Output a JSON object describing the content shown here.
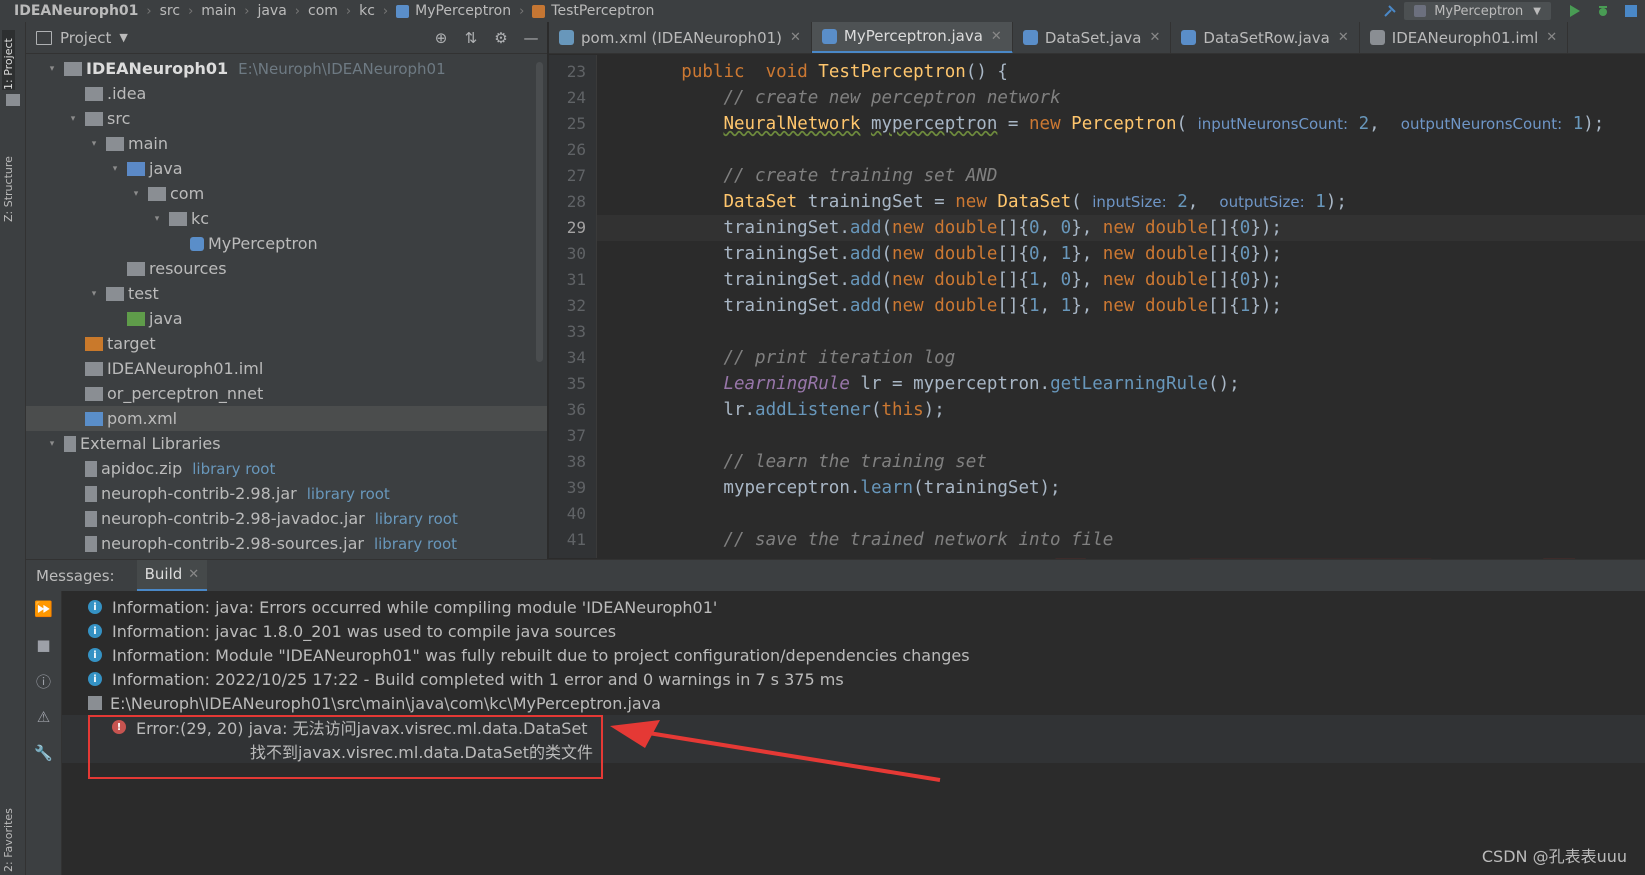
{
  "breadcrumb": [
    {
      "name": "IDEANeuroph01",
      "bold": true
    },
    {
      "name": "src"
    },
    {
      "name": "main"
    },
    {
      "name": "java"
    },
    {
      "name": "com"
    },
    {
      "name": "kc"
    },
    {
      "name": "MyPerceptron",
      "icon": "class-icon"
    },
    {
      "name": "TestPerceptron",
      "icon": "method-icon"
    }
  ],
  "run_config": {
    "name": "MyPerceptron"
  },
  "left_strip": {
    "project_tab": "1: Project",
    "structure_tab": "Z: Structure",
    "favorites_tab": "2: Favorites"
  },
  "project_panel": {
    "title": "Project",
    "tree": [
      {
        "label": "IDEANeuroph01",
        "hint": "E:\\Neuroph\\IDEANeuroph01",
        "depth": 0,
        "icon": "module-folder-icon",
        "bold": true,
        "expanded": true
      },
      {
        "label": ".idea",
        "depth": 1,
        "icon": "folder-icon"
      },
      {
        "label": "src",
        "depth": 1,
        "icon": "folder-icon",
        "expanded": true
      },
      {
        "label": "main",
        "depth": 2,
        "icon": "folder-icon",
        "expanded": true
      },
      {
        "label": "java",
        "depth": 3,
        "icon": "source-folder-icon",
        "expanded": true
      },
      {
        "label": "com",
        "depth": 4,
        "icon": "package-icon",
        "expanded": true
      },
      {
        "label": "kc",
        "depth": 5,
        "icon": "package-icon",
        "expanded": true
      },
      {
        "label": "MyPerceptron",
        "depth": 6,
        "icon": "java-class-icon"
      },
      {
        "label": "resources",
        "depth": 3,
        "icon": "resources-folder-icon"
      },
      {
        "label": "test",
        "depth": 2,
        "icon": "folder-icon",
        "expanded": true
      },
      {
        "label": "java",
        "depth": 3,
        "icon": "test-folder-icon"
      },
      {
        "label": "target",
        "depth": 1,
        "icon": "excluded-folder-icon"
      },
      {
        "label": "IDEANeuroph01.iml",
        "depth": 1,
        "icon": "iml-file-icon"
      },
      {
        "label": "or_perceptron_nnet",
        "depth": 1,
        "icon": "file-icon"
      },
      {
        "label": "pom.xml",
        "depth": 1,
        "icon": "maven-icon",
        "selected": true
      },
      {
        "label": "External Libraries",
        "depth": 0,
        "icon": "library-icon",
        "expanded": true
      },
      {
        "label": "apidoc.zip",
        "hint": "library root",
        "depth": 1,
        "icon": "jar-icon"
      },
      {
        "label": "neuroph-contrib-2.98.jar",
        "hint": "library root",
        "depth": 1,
        "icon": "jar-icon"
      },
      {
        "label": "neuroph-contrib-2.98-javadoc.jar",
        "hint": "library root",
        "depth": 1,
        "icon": "jar-icon"
      },
      {
        "label": "neuroph-contrib-2.98-sources.jar",
        "hint": "library root",
        "depth": 1,
        "icon": "jar-icon"
      }
    ]
  },
  "editor_tabs": [
    {
      "label": "pom.xml (IDEANeuroph01)",
      "icon": "maven-icon"
    },
    {
      "label": "MyPerceptron.java",
      "icon": "java-class-icon",
      "active": true
    },
    {
      "label": "DataSet.java",
      "icon": "class-icon"
    },
    {
      "label": "DataSetRow.java",
      "icon": "class-icon"
    },
    {
      "label": "IDEANeuroph01.iml",
      "icon": "iml-file-icon"
    }
  ],
  "code": {
    "first_line": 23,
    "current_line": 29,
    "lines": [
      [
        {
          "t": "        "
        },
        {
          "t": "public",
          "c": "kw"
        },
        {
          "t": "  "
        },
        {
          "t": "void",
          "c": "kw"
        },
        {
          "t": " "
        },
        {
          "t": "TestPerceptron",
          "c": "fn"
        },
        {
          "t": "() {"
        }
      ],
      [
        {
          "t": "            "
        },
        {
          "t": "// create new perceptron network",
          "c": "cm"
        }
      ],
      [
        {
          "t": "            "
        },
        {
          "t": "NeuralNetwork",
          "c": "ty under"
        },
        {
          "t": " "
        },
        {
          "t": "myperceptron",
          "c": "under"
        },
        {
          "t": " = "
        },
        {
          "t": "new",
          "c": "kw"
        },
        {
          "t": " "
        },
        {
          "t": "Perceptron",
          "c": "ty"
        },
        {
          "t": "( "
        },
        {
          "t": "inputNeuronsCount:",
          "c": "ph"
        },
        {
          "t": " "
        },
        {
          "t": "2",
          "c": "nb"
        },
        {
          "t": ",  "
        },
        {
          "t": "outputNeuronsCount:",
          "c": "ph"
        },
        {
          "t": " "
        },
        {
          "t": "1",
          "c": "nb"
        },
        {
          "t": ");"
        }
      ],
      [
        {
          "t": ""
        }
      ],
      [
        {
          "t": "            "
        },
        {
          "t": "// create training set AND",
          "c": "cm"
        }
      ],
      [
        {
          "t": "            "
        },
        {
          "t": "DataSet",
          "c": "ty"
        },
        {
          "t": " trainingSet = "
        },
        {
          "t": "new",
          "c": "kw"
        },
        {
          "t": " "
        },
        {
          "t": "DataSet",
          "c": "ty"
        },
        {
          "t": "( "
        },
        {
          "t": "inputSize:",
          "c": "ph"
        },
        {
          "t": " "
        },
        {
          "t": "2",
          "c": "nb"
        },
        {
          "t": ",  "
        },
        {
          "t": "outputSize:",
          "c": "ph"
        },
        {
          "t": " "
        },
        {
          "t": "1",
          "c": "nb"
        },
        {
          "t": ");"
        }
      ],
      [
        {
          "t": "            trainingSet."
        },
        {
          "t": "add",
          "c": "nb"
        },
        {
          "t": "("
        },
        {
          "t": "new",
          "c": "kw"
        },
        {
          "t": " "
        },
        {
          "t": "double",
          "c": "kw"
        },
        {
          "t": "[]{"
        },
        {
          "t": "0",
          "c": "nb"
        },
        {
          "t": ", "
        },
        {
          "t": "0",
          "c": "nb"
        },
        {
          "t": "}, "
        },
        {
          "t": "new",
          "c": "kw"
        },
        {
          "t": " "
        },
        {
          "t": "double",
          "c": "kw"
        },
        {
          "t": "[]{"
        },
        {
          "t": "0",
          "c": "nb"
        },
        {
          "t": "});"
        }
      ],
      [
        {
          "t": "            trainingSet."
        },
        {
          "t": "add",
          "c": "nb"
        },
        {
          "t": "("
        },
        {
          "t": "new",
          "c": "kw"
        },
        {
          "t": " "
        },
        {
          "t": "double",
          "c": "kw"
        },
        {
          "t": "[]{"
        },
        {
          "t": "0",
          "c": "nb"
        },
        {
          "t": ", "
        },
        {
          "t": "1",
          "c": "nb"
        },
        {
          "t": "}, "
        },
        {
          "t": "new",
          "c": "kw"
        },
        {
          "t": " "
        },
        {
          "t": "double",
          "c": "kw"
        },
        {
          "t": "[]{"
        },
        {
          "t": "0",
          "c": "nb"
        },
        {
          "t": "});"
        }
      ],
      [
        {
          "t": "            trainingSet."
        },
        {
          "t": "add",
          "c": "nb"
        },
        {
          "t": "("
        },
        {
          "t": "new",
          "c": "kw"
        },
        {
          "t": " "
        },
        {
          "t": "double",
          "c": "kw"
        },
        {
          "t": "[]{"
        },
        {
          "t": "1",
          "c": "nb"
        },
        {
          "t": ", "
        },
        {
          "t": "0",
          "c": "nb"
        },
        {
          "t": "}, "
        },
        {
          "t": "new",
          "c": "kw"
        },
        {
          "t": " "
        },
        {
          "t": "double",
          "c": "kw"
        },
        {
          "t": "[]{"
        },
        {
          "t": "0",
          "c": "nb"
        },
        {
          "t": "});"
        }
      ],
      [
        {
          "t": "            trainingSet."
        },
        {
          "t": "add",
          "c": "nb"
        },
        {
          "t": "("
        },
        {
          "t": "new",
          "c": "kw"
        },
        {
          "t": " "
        },
        {
          "t": "double",
          "c": "kw"
        },
        {
          "t": "[]{"
        },
        {
          "t": "1",
          "c": "nb"
        },
        {
          "t": ", "
        },
        {
          "t": "1",
          "c": "nb"
        },
        {
          "t": "}, "
        },
        {
          "t": "new",
          "c": "kw"
        },
        {
          "t": " "
        },
        {
          "t": "double",
          "c": "kw"
        },
        {
          "t": "[]{"
        },
        {
          "t": "1",
          "c": "nb"
        },
        {
          "t": "});"
        }
      ],
      [
        {
          "t": ""
        }
      ],
      [
        {
          "t": "            "
        },
        {
          "t": "// print iteration log",
          "c": "cm"
        }
      ],
      [
        {
          "t": "            "
        },
        {
          "t": "LearningRule",
          "c": "it"
        },
        {
          "t": " lr = myperceptron."
        },
        {
          "t": "getLearningRule",
          "c": "nb"
        },
        {
          "t": "();"
        }
      ],
      [
        {
          "t": "            lr."
        },
        {
          "t": "addListener",
          "c": "nb"
        },
        {
          "t": "("
        },
        {
          "t": "this",
          "c": "kw"
        },
        {
          "t": ");"
        }
      ],
      [
        {
          "t": ""
        }
      ],
      [
        {
          "t": "            "
        },
        {
          "t": "// learn the training set",
          "c": "cm"
        }
      ],
      [
        {
          "t": "            myperceptron."
        },
        {
          "t": "learn",
          "c": "nb"
        },
        {
          "t": "(trainingSet);"
        }
      ],
      [
        {
          "t": ""
        }
      ],
      [
        {
          "t": "            "
        },
        {
          "t": "// save the trained network into file",
          "c": "cm"
        }
      ]
    ]
  },
  "messages": {
    "title": "Messages:",
    "tab": "Build",
    "lines": [
      {
        "kind": "info",
        "text": "Information: java: Errors occurred while compiling module 'IDEANeuroph01'"
      },
      {
        "kind": "info",
        "text": "Information: javac 1.8.0_201 was used to compile java sources"
      },
      {
        "kind": "info",
        "text": "Information: Module \"IDEANeuroph01\" was fully rebuilt due to project configuration/dependencies changes"
      },
      {
        "kind": "info",
        "text": "Information: 2022/10/25 17:22 - Build completed with 1 error and 0 warnings in 7 s 375 ms"
      },
      {
        "kind": "file",
        "text": "E:\\Neuroph\\IDEANeuroph01\\src\\main\\java\\com\\kc\\MyPerceptron.java"
      },
      {
        "kind": "error",
        "text": "Error:(29, 20)  java: 无法访问javax.visrec.ml.data.DataSet"
      },
      {
        "kind": "error2",
        "text": "找不到javax.visrec.ml.data.DataSet的类文件"
      }
    ]
  },
  "watermark": "CSDN @孔表表uuu",
  "colors": {
    "accent": "#4a88c7",
    "error_box": "#e53935",
    "arrow": "#e53935"
  }
}
